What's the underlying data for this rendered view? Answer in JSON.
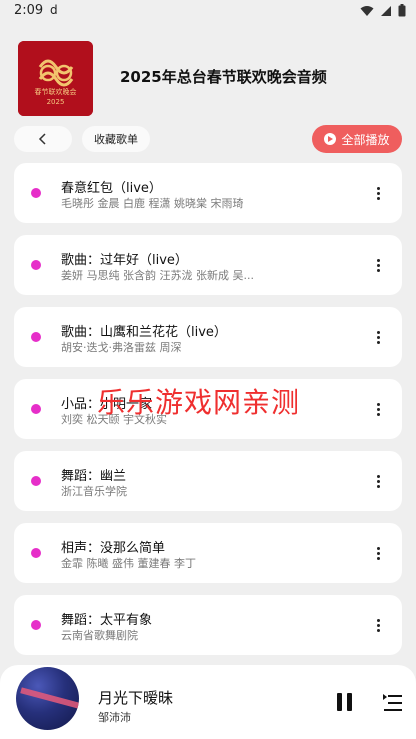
{
  "status_bar": {
    "time": "2:09",
    "indicator": "d",
    "icons": [
      "wifi-icon",
      "signal-icon",
      "battery-icon"
    ]
  },
  "header": {
    "title": "2025年总台春节联欢晚会音频",
    "cover_caption": "春节联欢晚会",
    "cover_year": "2025"
  },
  "toolbar": {
    "back_icon": "chevron-left-icon",
    "collect_label": "收藏歌单",
    "play_all_label": "全部播放"
  },
  "songs": [
    {
      "title": "春意红包（live）",
      "artist": "毛晓彤 金晨 白鹿 程潇 姚晓棠 宋雨琦"
    },
    {
      "title": "歌曲：过年好（live）",
      "artist": "姜妍 马思纯 张含韵 汪苏泷 张新成 吴..."
    },
    {
      "title": "歌曲：山鹰和兰花花（live）",
      "artist": "胡安·迭戈·弗洛雷兹 周深"
    },
    {
      "title": "小品：小明一家",
      "artist": "刘奕 松天颐 宇文秋实"
    },
    {
      "title": "舞蹈：幽兰",
      "artist": "浙江音乐学院"
    },
    {
      "title": "相声：没那么简单",
      "artist": "金霏 陈曦 盛伟 董建春 李丁"
    },
    {
      "title": "舞蹈：太平有象",
      "artist": "云南省歌舞剧院"
    }
  ],
  "watermark": "乐乐游戏网亲测",
  "player": {
    "song": "月光下暧昧",
    "artist": "邹沛沛",
    "pause_icon": "pause-icon",
    "queue_icon": "playlist-icon"
  },
  "colors": {
    "accent": "#ef5e5e",
    "dot": "#e62ec9",
    "watermark": "#ef2f2f",
    "background": "#efefef"
  }
}
